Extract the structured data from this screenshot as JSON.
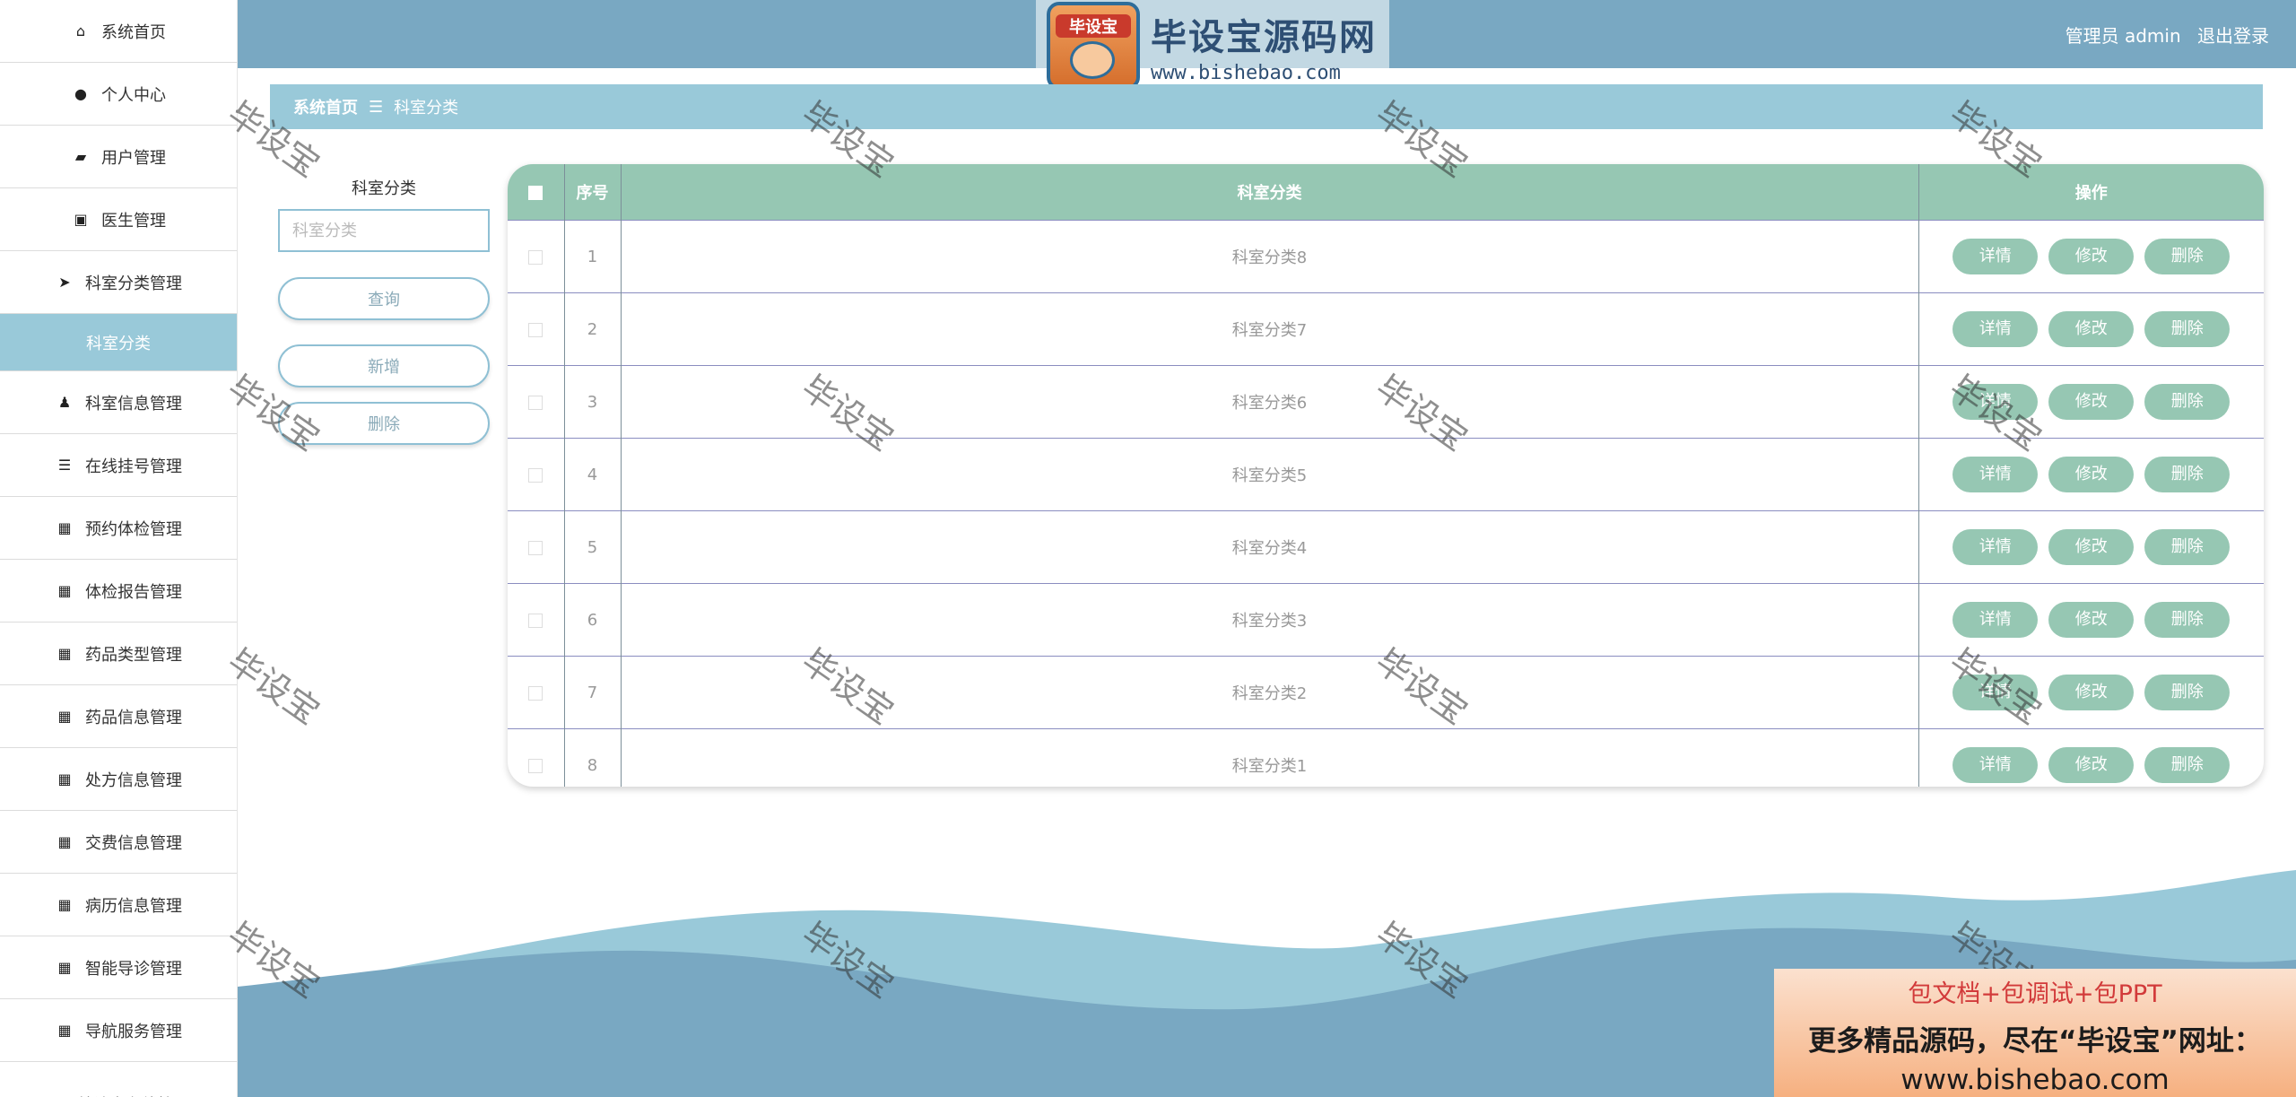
{
  "sidebar": {
    "items": [
      {
        "label": "系统首页",
        "icon": "home-icon",
        "glyph": "⌂"
      },
      {
        "label": "个人中心",
        "icon": "user-icon",
        "glyph": "●"
      },
      {
        "label": "用户管理",
        "icon": "ticket-icon",
        "glyph": "▰"
      },
      {
        "label": "医生管理",
        "icon": "clipboard-icon",
        "glyph": "▣"
      },
      {
        "label": "科室分类管理",
        "icon": "send-icon",
        "glyph": "➤"
      },
      {
        "label": "科室分类",
        "icon": "",
        "glyph": ""
      },
      {
        "label": "科室信息管理",
        "icon": "stamp-icon",
        "glyph": "♟"
      },
      {
        "label": "在线挂号管理",
        "icon": "sliders-icon",
        "glyph": "☰"
      },
      {
        "label": "预约体检管理",
        "icon": "grid-icon",
        "glyph": "▦"
      },
      {
        "label": "体检报告管理",
        "icon": "apps-icon",
        "glyph": "▦"
      },
      {
        "label": "药品类型管理",
        "icon": "apps-icon",
        "glyph": "▦"
      },
      {
        "label": "药品信息管理",
        "icon": "apps-icon",
        "glyph": "▦"
      },
      {
        "label": "处方信息管理",
        "icon": "apps-icon",
        "glyph": "▦"
      },
      {
        "label": "交费信息管理",
        "icon": "apps-icon",
        "glyph": "▦"
      },
      {
        "label": "病历信息管理",
        "icon": "apps-icon",
        "glyph": "▦"
      },
      {
        "label": "智能导诊管理",
        "icon": "apps-icon",
        "glyph": "▦"
      },
      {
        "label": "导航服务管理",
        "icon": "apps-icon",
        "glyph": "▦"
      },
      {
        "label": "就诊点在线管理",
        "icon": "pie-icon",
        "glyph": "◔"
      }
    ]
  },
  "header": {
    "logo_badge": "毕设宝",
    "logo_title": "毕设宝源码网",
    "logo_url": "www.bishebao.com",
    "user_label": "管理员 admin",
    "logout_label": "退出登录"
  },
  "breadcrumb": {
    "home": "系统首页",
    "separator": "☰",
    "current": "科室分类"
  },
  "search": {
    "label": "科室分类",
    "placeholder": "科室分类",
    "query_button": "查询",
    "add_button": "新增",
    "delete_button": "删除"
  },
  "table": {
    "headers": {
      "index": "序号",
      "category": "科室分类",
      "actions": "操作"
    },
    "action_labels": {
      "detail": "详情",
      "edit": "修改",
      "delete": "删除"
    },
    "rows": [
      {
        "index": "1",
        "category": "科室分类8"
      },
      {
        "index": "2",
        "category": "科室分类7"
      },
      {
        "index": "3",
        "category": "科室分类6"
      },
      {
        "index": "4",
        "category": "科室分类5"
      },
      {
        "index": "5",
        "category": "科室分类4"
      },
      {
        "index": "6",
        "category": "科室分类3"
      },
      {
        "index": "7",
        "category": "科室分类2"
      },
      {
        "index": "8",
        "category": "科室分类1"
      }
    ]
  },
  "watermark": "毕设宝",
  "promo": {
    "line1": "包文档+包调试+包PPT",
    "line2": "更多精品源码，尽在“毕设宝”网址：",
    "line3": "www.bishebao.com"
  },
  "colors": {
    "topbar": "#79a8c2",
    "accent": "#99c9d9",
    "table_header": "#96c7b3",
    "wave_dark": "#79a8c2",
    "wave_light": "#99c9d9"
  }
}
